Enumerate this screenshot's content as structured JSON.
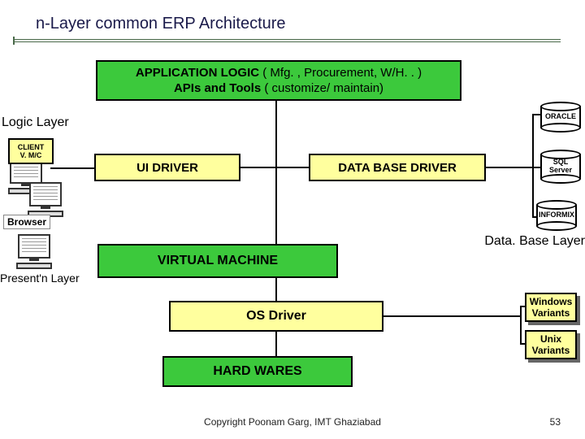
{
  "title": "n-Layer common ERP Architecture",
  "boxes": {
    "app_line1_bold": "APPLICATION  LOGIC",
    "app_line1_rest": " ( Mfg. , Procurement, W/H. . )",
    "app_line2_bold": "APIs  and  Tools",
    "app_line2_rest": " ( customize/ maintain)",
    "ui_driver": "UI DRIVER",
    "db_driver": "DATA BASE DRIVER",
    "vm": "VIRTUAL MACHINE",
    "os": "OS Driver",
    "hw": "HARD WARES"
  },
  "labels": {
    "logic_layer": "Logic Layer",
    "db_layer": "Data. Base Layer",
    "presentation_layer": "Present'n Layer",
    "browser": "Browser"
  },
  "client": {
    "l1": "CLIENT",
    "l2": "V. M/C"
  },
  "dbs": {
    "oracle": "ORACLE",
    "sql_l1": "SQL",
    "sql_l2": "Server",
    "informix": "INFORMIX"
  },
  "os_variants": {
    "win_l1": "Windows",
    "win_l2": "Variants",
    "unix_l1": "Unix",
    "unix_l2": "Variants"
  },
  "footer": "Copyright Poonam Garg, IMT Ghaziabad",
  "page": "53"
}
